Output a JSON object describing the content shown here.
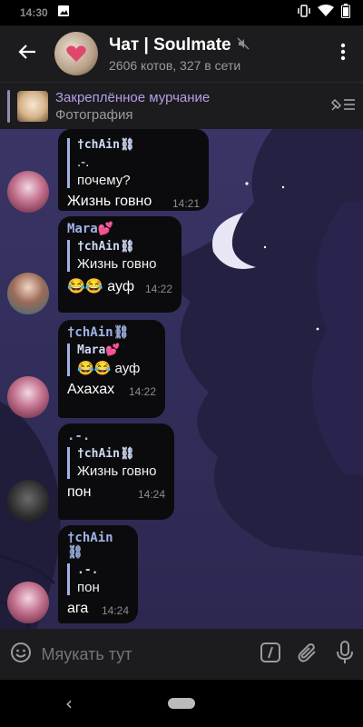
{
  "status": {
    "time": "14:30"
  },
  "header": {
    "title": "Чат | Soulmate",
    "subtitle": "2606 котов, 327 в сети"
  },
  "pinned": {
    "title": "Закреплённое мурчание",
    "subtitle": "Фотография"
  },
  "messages": [
    {
      "reply_name": "†chAin⛓",
      "reply_text": ".-.",
      "lines": [
        "почему?",
        "Жизнь говно"
      ],
      "time": "14:21"
    },
    {
      "sender": "Mara💕",
      "reply_name": "†chAin⛓",
      "reply_text": "Жизнь говно",
      "text": "😂😂 ауф",
      "time": "14:22"
    },
    {
      "sender": "†chAin⛓",
      "reply_name": "Mara💕",
      "reply_text": "😂😂 ауф",
      "text": "Ахахах",
      "time": "14:22"
    },
    {
      "sender": ".-.",
      "reply_name": "†chAin⛓",
      "reply_text": "Жизнь говно",
      "text": "пон",
      "time": "14:24"
    },
    {
      "sender": "†chAin⛓",
      "reply_name": ".-.",
      "reply_text": "пон",
      "text": "ага",
      "time": "14:24"
    }
  ],
  "input": {
    "placeholder": "Мяукать тут"
  },
  "icons": {
    "back": "arrow-left-icon",
    "menu": "more-vertical-icon",
    "mute": "muted-speaker-icon",
    "unpin": "unpin-icon",
    "emoji": "emoji-icon",
    "commands": "slash-command-icon",
    "attach": "paperclip-icon",
    "mic": "microphone-icon"
  },
  "colors": {
    "accent": "#9fb3e6",
    "pinned_title": "#b49ee6",
    "bubble": "#0b0b0d"
  }
}
